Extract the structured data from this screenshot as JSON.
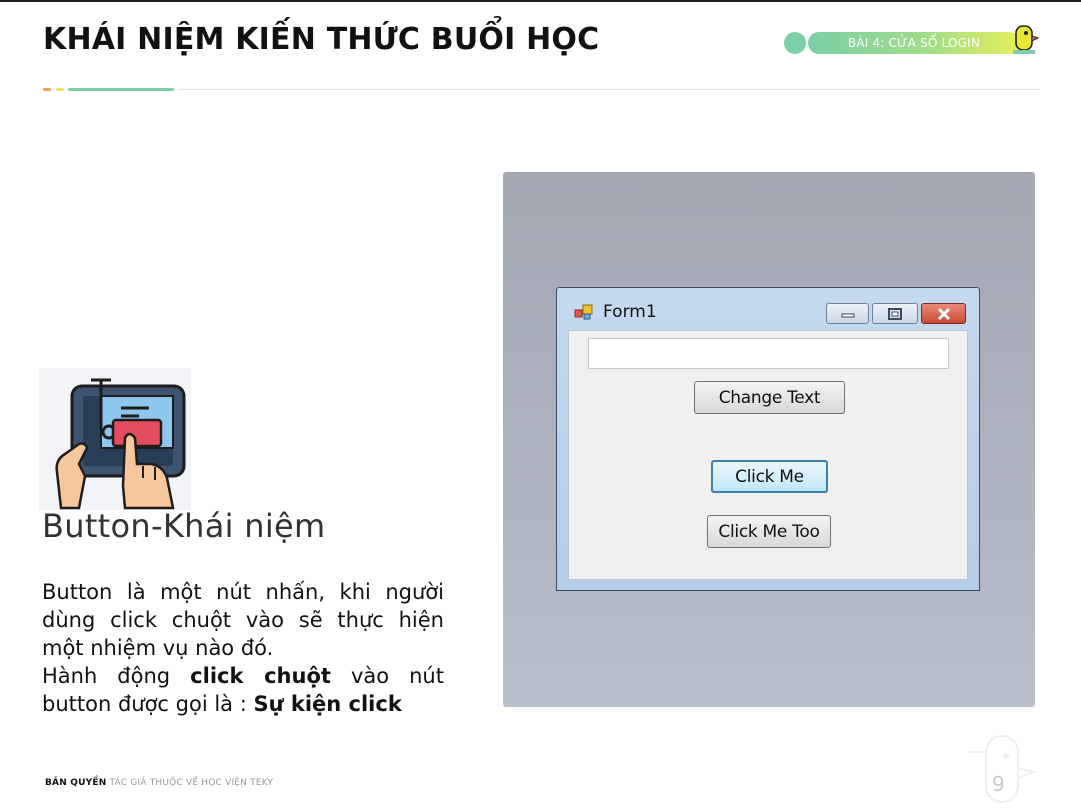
{
  "header": {
    "title": "KHÁI NIỆM KIẾN THỨC BUỔI HỌC",
    "lesson_tag": "BÀI 4: CỬA SỔ LOGIN"
  },
  "content": {
    "heading": "Button-Khái niệm",
    "paragraph_lines": [
      "Button là một nút nhấn, khi người",
      "dùng click chuột vào sẽ thực hiện",
      "một nhiệm vụ nào đó."
    ],
    "action_prefix": "Hành động",
    "action_bold": "click chuột",
    "action_suffix": "vào nút",
    "event_prefix": "button được gọi là :",
    "event_bold": "Sự kiện click"
  },
  "demo_window": {
    "title": "Form1",
    "textbox_value": "",
    "buttons": {
      "change_text": "Change Text",
      "click_me": "Click Me",
      "click_me_too": "Click Me Too"
    }
  },
  "footer": {
    "copyright_bold": "BẢN QUYỀN",
    "copyright_rest": "TÁC GIẢ THUỘC VỀ HỌC VIỆN TEKY",
    "page_number": "9"
  },
  "colors": {
    "accent_green": "#7ccfa6",
    "accent_yellow": "#e6ef5a",
    "accent_orange": "#f2a553"
  },
  "icons": [
    "tablet-touch-icon",
    "form-app-icon",
    "minimize-icon",
    "maximize-icon",
    "close-icon",
    "teky-mascot-icon"
  ]
}
